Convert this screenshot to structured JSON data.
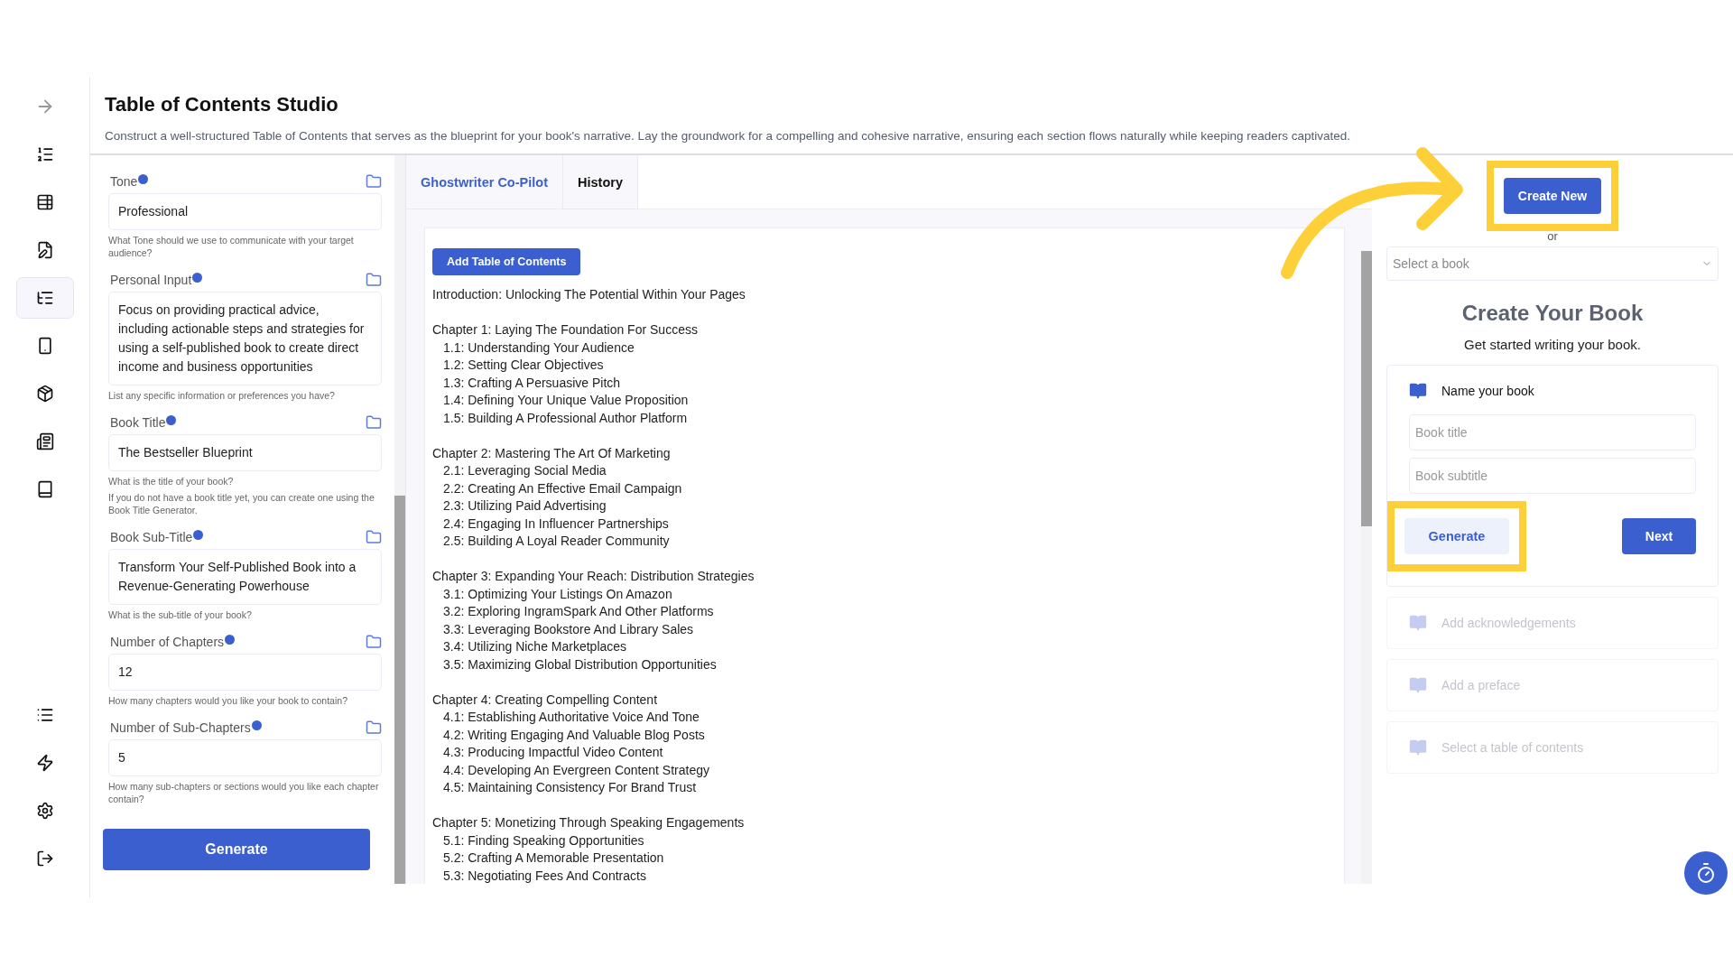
{
  "sidebar": {
    "items": [
      {
        "selected": false
      },
      {
        "selected": false
      },
      {
        "selected": false
      },
      {
        "selected": false
      },
      {
        "selected": true
      },
      {
        "selected": false
      },
      {
        "selected": false
      },
      {
        "selected": false
      },
      {
        "selected": false
      },
      {
        "selected": false
      },
      {
        "selected": false
      },
      {
        "selected": false
      },
      {
        "selected": false
      }
    ]
  },
  "header": {
    "title": "Table of Contents Studio",
    "description": "Construct a well-structured Table of Contents that serves as the blueprint for your book's narrative. Lay the groundwork for a compelling and cohesive narrative, ensuring each section flows naturally while keeping readers captivated."
  },
  "form": {
    "fields": [
      {
        "label": "Tone",
        "value": "Professional",
        "help": [
          "What Tone should we use to communicate with your target audience?"
        ]
      },
      {
        "label": "Personal Input",
        "value": "Focus on providing practical advice, including actionable steps and strategies for using a self-published book to create direct income and business opportunities",
        "help": [
          "List any specific information or preferences you have?"
        ]
      },
      {
        "label": "Book Title",
        "value": "The Bestseller Blueprint",
        "help": [
          "What is the title of your book?",
          "If you do not have a book title yet, you can create one using the Book Title Generator."
        ]
      },
      {
        "label": "Book Sub-Title",
        "value": "Transform Your Self-Published Book into a Revenue-Generating Powerhouse",
        "help": [
          "What is the sub-title of your book?"
        ]
      },
      {
        "label": "Number of Chapters",
        "value": "12",
        "help": [
          "How many chapters would you like your book to contain?"
        ]
      },
      {
        "label": "Number of Sub-Chapters",
        "value": "5",
        "help": [
          "How many sub-chapters or sections would you like each chapter contain?"
        ]
      }
    ],
    "submit": "Generate"
  },
  "tabs": [
    {
      "label": "Ghostwriter Co-Pilot",
      "selected": true
    },
    {
      "label": "History",
      "selected": false
    }
  ],
  "toc": {
    "add_button": "Add Table of Contents",
    "entries": [
      {
        "title": "Introduction: Unlocking The Potential Within Your Pages"
      },
      {
        "title": "Chapter 1: Laying The Foundation For Success",
        "children": [
          "1.1: Understanding Your Audience",
          "1.2: Setting Clear Objectives",
          "1.3: Crafting A Persuasive Pitch",
          "1.4: Defining Your Unique Value Proposition",
          "1.5: Building A Professional Author Platform"
        ]
      },
      {
        "title": "Chapter 2: Mastering The Art Of Marketing",
        "children": [
          "2.1: Leveraging Social Media",
          "2.2: Creating An Effective Email Campaign",
          "2.3: Utilizing Paid Advertising",
          "2.4: Engaging In Influencer Partnerships",
          "2.5: Building A Loyal Reader Community"
        ]
      },
      {
        "title": "Chapter 3: Expanding Your Reach: Distribution Strategies",
        "children": [
          "3.1: Optimizing Your Listings On Amazon",
          "3.2: Exploring IngramSpark And Other Platforms",
          "3.3: Leveraging Bookstore And Library Sales",
          "3.4: Utilizing Niche Marketplaces",
          "3.5: Maximizing Global Distribution Opportunities"
        ]
      },
      {
        "title": "Chapter 4: Creating Compelling Content",
        "children": [
          "4.1: Establishing Authoritative Voice And Tone",
          "4.2: Writing Engaging And Valuable Blog Posts",
          "4.3: Producing Impactful Video Content",
          "4.4: Developing An Evergreen Content Strategy",
          "4.5: Maintaining Consistency For Brand Trust"
        ]
      },
      {
        "title": "Chapter 5: Monetizing Through Speaking Engagements",
        "children": [
          "5.1: Finding Speaking Opportunities",
          "5.2: Crafting A Memorable Presentation",
          "5.3: Negotiating Fees And Contracts"
        ]
      }
    ]
  },
  "book_panel": {
    "create_button": {
      "label": "Create New",
      "highlighted": true
    },
    "or": "or",
    "select": {
      "placeholder": "Select a book"
    },
    "title": "Create Your Book",
    "subtitle": "Get started writing your book.",
    "steps": [
      {
        "label": "Name your book",
        "disabled": false,
        "inputs": [
          {
            "placeholder": "Book title"
          },
          {
            "placeholder": "Book subtitle"
          }
        ],
        "generate": {
          "label": "Generate",
          "highlighted": true
        },
        "next": "Next"
      },
      {
        "label": "Add acknowledgements",
        "disabled": true
      },
      {
        "label": "Add a preface",
        "disabled": true
      },
      {
        "label": "Select a table of contents",
        "disabled": true
      }
    ]
  }
}
